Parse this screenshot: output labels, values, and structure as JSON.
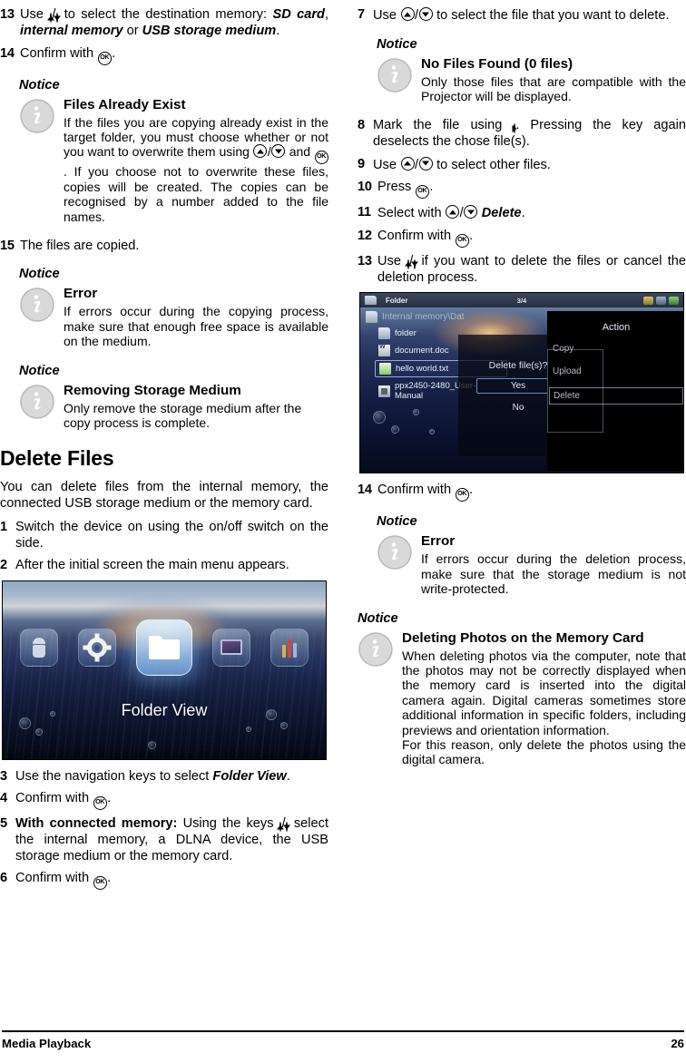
{
  "footer": {
    "section": "Media Playback",
    "page": "26"
  },
  "left_column": {
    "steps_top": [
      {
        "num": "13",
        "segments": [
          {
            "t": "Use "
          },
          {
            "k": "up"
          },
          {
            "t": "/"
          },
          {
            "k": "down"
          },
          {
            "t": " to select the destination memory: "
          },
          {
            "bi": "SD card"
          },
          {
            "t": ", "
          },
          {
            "bi": "internal memory"
          },
          {
            "t": " or "
          },
          {
            "bi": "USB storage medium"
          },
          {
            "t": "."
          }
        ]
      },
      {
        "num": "14",
        "segments": [
          {
            "t": "Confirm with "
          },
          {
            "k": "ok"
          },
          {
            "t": "."
          }
        ]
      }
    ],
    "notice_files_exist": {
      "label": "Notice",
      "title": "Files Already Exist",
      "paragraph_parts": [
        {
          "t": "If the files you are copying already exist in the target folder, you must choose whether or not you want to overwrite them using "
        },
        {
          "k": "up"
        },
        {
          "t": "/"
        },
        {
          "k": "down"
        },
        {
          "t": " and "
        },
        {
          "k": "ok"
        },
        {
          "t": ". If you choose not to overwrite these files, copies will be created. The copies can be recognised by a number added to the file names."
        }
      ]
    },
    "step_15": {
      "num": "15",
      "text": "The files are copied."
    },
    "notice_error_copy": {
      "label": "Notice",
      "title": "Error",
      "text": "If errors occur during the copying process, make sure that enough free space is available on the medium."
    },
    "notice_removing": {
      "label": "Notice",
      "title": "Removing Storage Medium",
      "text": "Only remove the storage medium after the copy process is complete."
    },
    "section_title": "Delete Files",
    "intro": "You can delete files from the internal memory, the connected USB storage medium or the memory card.",
    "steps_delete": [
      {
        "num": "1",
        "segments": [
          {
            "t": "Switch the device on using the on/off switch on the side."
          }
        ]
      },
      {
        "num": "2",
        "segments": [
          {
            "t": "After the initial screen the main menu appears."
          }
        ]
      }
    ],
    "steps_after_figure": [
      {
        "num": "3",
        "segments": [
          {
            "t": "Use the navigation keys to select "
          },
          {
            "bi": "Folder View"
          },
          {
            "t": "."
          }
        ]
      },
      {
        "num": "4",
        "segments": [
          {
            "t": "Confirm with "
          },
          {
            "k": "ok"
          },
          {
            "t": "."
          }
        ]
      },
      {
        "num": "5",
        "segments": [
          {
            "b": "With connected memory:"
          },
          {
            "t": " Using the keys "
          },
          {
            "k": "up"
          },
          {
            "t": "/"
          },
          {
            "k": "down"
          },
          {
            "t": " select the internal memory, a DLNA device, the USB storage medium or the memory card."
          }
        ]
      },
      {
        "num": "6",
        "segments": [
          {
            "t": "Confirm with "
          },
          {
            "k": "ok"
          },
          {
            "t": "."
          }
        ]
      }
    ],
    "figure_main_menu": {
      "caption_label": "Folder View",
      "icons": [
        {
          "name": "android-icon",
          "label": "Android"
        },
        {
          "name": "settings-icon",
          "label": "Settings"
        },
        {
          "name": "folder-view-icon",
          "label": "Folder View",
          "selected": true
        },
        {
          "name": "video-icon",
          "label": "Video"
        },
        {
          "name": "music-icon",
          "label": "Music"
        }
      ]
    }
  },
  "right_column": {
    "step_7": {
      "num": "7",
      "segments": [
        {
          "t": "Use "
        },
        {
          "k": "up"
        },
        {
          "t": "/"
        },
        {
          "k": "down"
        },
        {
          "t": " to select the file that you want to delete."
        }
      ]
    },
    "notice_no_files": {
      "label": "Notice",
      "title": "No Files Found (0 files)",
      "text": "Only those files that are compatible with the Projector will be displayed."
    },
    "steps_mid": [
      {
        "num": "8",
        "segments": [
          {
            "t": "Mark the file using "
          },
          {
            "k": "right"
          },
          {
            "t": ". Pressing the key again deselects the chose file(s)."
          }
        ]
      },
      {
        "num": "9",
        "segments": [
          {
            "t": "Use "
          },
          {
            "k": "up"
          },
          {
            "t": "/"
          },
          {
            "k": "down"
          },
          {
            "t": " to select other files."
          }
        ]
      },
      {
        "num": "10",
        "segments": [
          {
            "t": "Press "
          },
          {
            "k": "ok"
          },
          {
            "t": "."
          }
        ]
      },
      {
        "num": "11",
        "segments": [
          {
            "t": "Select with "
          },
          {
            "k": "up"
          },
          {
            "t": "/"
          },
          {
            "k": "down"
          },
          {
            "t": " "
          },
          {
            "bi": "Delete"
          },
          {
            "t": "."
          }
        ]
      },
      {
        "num": "12",
        "segments": [
          {
            "t": "Confirm with "
          },
          {
            "k": "ok"
          },
          {
            "t": "."
          }
        ]
      },
      {
        "num": "13",
        "segments": [
          {
            "t": "Use "
          },
          {
            "k": "up"
          },
          {
            "t": "/"
          },
          {
            "k": "down"
          },
          {
            "t": " if you want to delete the files or cancel the deletion process."
          }
        ]
      }
    ],
    "figure_browser": {
      "topbar": {
        "title": "Folder",
        "page_indicator": "3/4"
      },
      "path": "Internal memory\\Dat",
      "files": [
        {
          "name": "folder",
          "icon": "folder-icon",
          "selected": false
        },
        {
          "name": "document.doc",
          "icon": "word-doc-icon",
          "selected": false
        },
        {
          "name": "hello world.txt",
          "icon": "text-file-icon",
          "selected": true
        },
        {
          "name": "ppx2450-2480_User-Manual",
          "icon": "pdf-file-icon",
          "selected": false
        }
      ],
      "confirm_dialog": {
        "title": "Delete file(s)?",
        "buttons": [
          {
            "label": "Yes",
            "selected": true
          },
          {
            "label": "No",
            "selected": false
          }
        ]
      },
      "action_menu": {
        "title": "Action",
        "items": [
          {
            "label": "Copy",
            "selected": false
          },
          {
            "label": "Upload",
            "selected": false
          },
          {
            "label": "Delete",
            "selected": true
          }
        ]
      }
    },
    "step_14": {
      "num": "14",
      "segments": [
        {
          "t": "Confirm with "
        },
        {
          "k": "ok"
        },
        {
          "t": "."
        }
      ]
    },
    "notice_error_delete": {
      "label": "Notice",
      "title": "Error",
      "text": "If errors occur during the deletion process, make sure that the storage medium is not write-protected."
    },
    "notice_deleting_photos": {
      "label": "Notice",
      "title": "Deleting Photos on the Memory Card",
      "paragraph1": "When deleting photos via the computer, note that the photos may not be correctly displayed when the memory card is inserted into the digital camera again. Digital cameras sometimes store additional information in specific folders, including previews and orientation information.",
      "paragraph2": "For this reason, only delete the photos using the digital camera."
    }
  }
}
